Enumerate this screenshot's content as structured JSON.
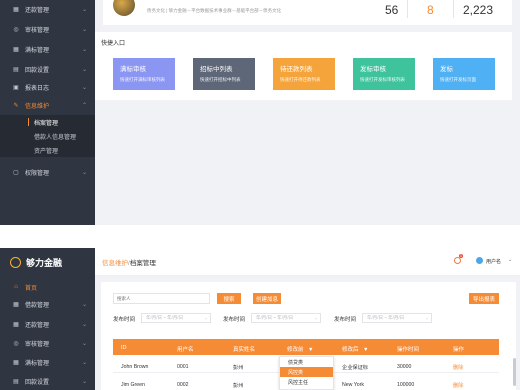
{
  "top": {
    "sidebar": [
      {
        "label": "还款管理",
        "icon": "grid-icon"
      },
      {
        "label": "审核管理",
        "icon": "check-circle-icon"
      },
      {
        "label": "满标管理",
        "icon": "grid-icon"
      },
      {
        "label": "回款设置",
        "icon": "document-icon"
      },
      {
        "label": "报表日志",
        "icon": "calendar-icon"
      },
      {
        "label": "信息维护",
        "icon": "pencil-icon"
      }
    ],
    "submenu": [
      "档案管理",
      "借款人信息管理",
      "资产管理"
    ],
    "permissions": "权限管理",
    "profile": {
      "name_partial": "…",
      "subtitle": "债务文化 | 够力金融－平台数据技术事业群－基础平台部－债务文化"
    },
    "stats": [
      "56",
      "8",
      "2,223"
    ],
    "quick_title": "快捷入口",
    "quick": [
      {
        "title": "满标审核",
        "desc": "快速打开满标审核列表",
        "color": "#8b96f2"
      },
      {
        "title": "招标中列表",
        "desc": "快速打开招标中列表",
        "color": "#5d6778"
      },
      {
        "title": "待还款列表",
        "desc": "快速打开待还款列表",
        "color": "#f4a43a"
      },
      {
        "title": "发标审核",
        "desc": "快速打开发标审核列表",
        "color": "#3ec39c"
      },
      {
        "title": "发标",
        "desc": "快速打开发标页面",
        "color": "#4fb1f4"
      }
    ]
  },
  "bottom": {
    "brand": "够力金融",
    "breadcrumb_link": "信息维护",
    "breadcrumb_sep": "/",
    "breadcrumb_current": "档案管理",
    "badge_count": "1",
    "user_label": "用户名",
    "sidebar": [
      {
        "label": "首页",
        "icon": "home-icon"
      },
      {
        "label": "借款管理",
        "icon": "grid-icon"
      },
      {
        "label": "还款管理",
        "icon": "grid-icon"
      },
      {
        "label": "审核管理",
        "icon": "check-circle-icon"
      },
      {
        "label": "满标管理",
        "icon": "grid-icon"
      },
      {
        "label": "回款设置",
        "icon": "document-icon"
      }
    ],
    "search_placeholder": "搜索人",
    "search_btn": "搜索",
    "create_btn": "创建加息",
    "export_btn": "导出报表",
    "date_label": "发布时间",
    "date_placeholder": "年/月/日 ~ 年/月/日",
    "table": {
      "headers": [
        "ID",
        "用户名",
        "真实姓名",
        "修改前",
        "修改后",
        "操作时间",
        "操作"
      ],
      "rows": [
        {
          "id": "John Brown",
          "user": "0001",
          "name": "彭州",
          "before": "",
          "after": "企业保证标",
          "amount": "30000",
          "op": "删除"
        },
        {
          "id": "Jim Green",
          "user": "0002",
          "name": "彭州",
          "before": "",
          "after": "New York",
          "amount": "100000",
          "op": "删除"
        }
      ],
      "dropdown": [
        "债贷类",
        "风控类",
        "风控主任"
      ]
    }
  }
}
